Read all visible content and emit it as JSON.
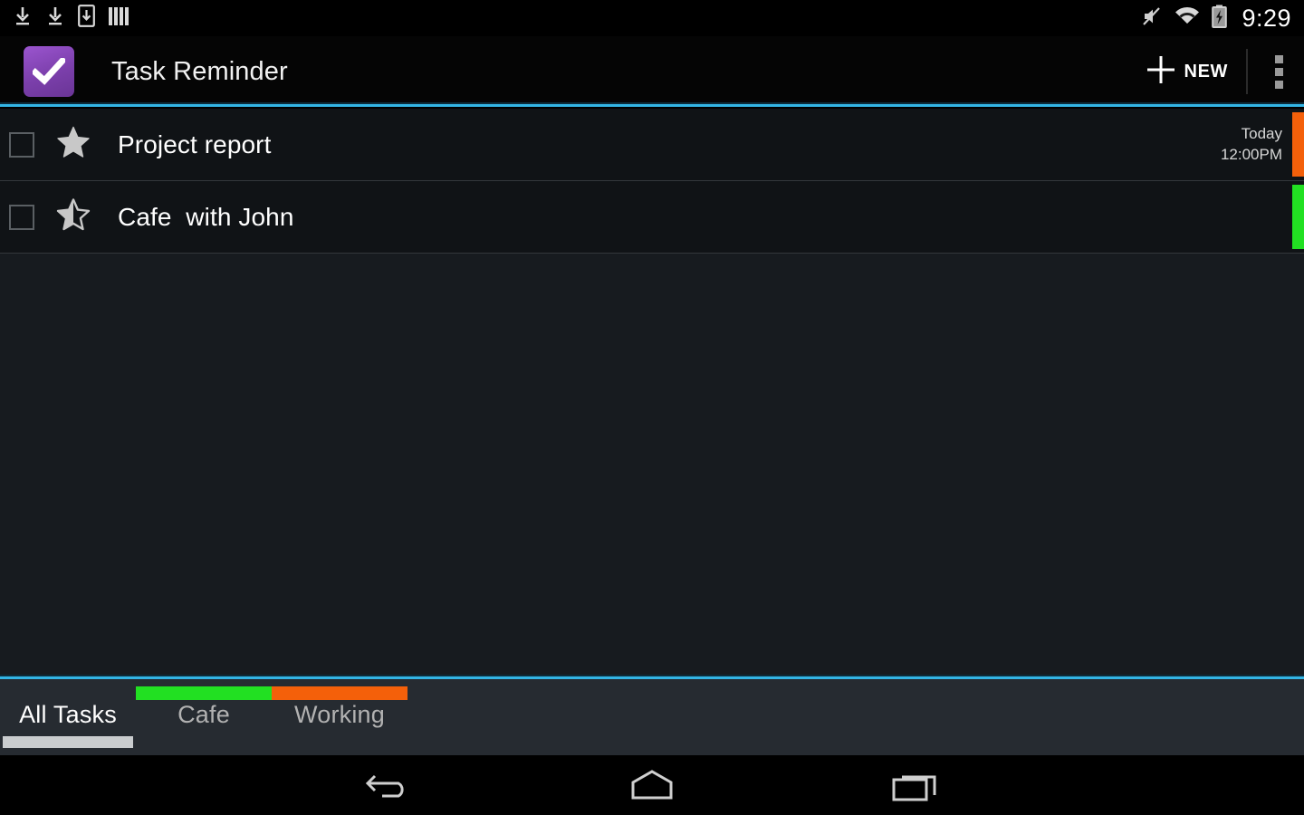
{
  "status_bar": {
    "left_icons": [
      {
        "name": "download-arrow-icon",
        "label": "download"
      },
      {
        "name": "download-arrow-icon",
        "label": "download"
      },
      {
        "name": "download-to-device-icon",
        "label": "save to device"
      },
      {
        "name": "equalizer-bars-icon",
        "label": "bars"
      }
    ],
    "right_icons": [
      {
        "name": "volume-muted-icon",
        "label": "silent"
      },
      {
        "name": "wifi-icon",
        "label": "wifi"
      },
      {
        "name": "battery-charging-icon",
        "label": "charging"
      }
    ],
    "time": "9:29"
  },
  "action_bar": {
    "app_icon": "checkmark-icon",
    "title": "Task Reminder",
    "new_label": "NEW",
    "plus_icon": "plus-icon",
    "overflow_icon": "overflow-menu-icon"
  },
  "tasks": [
    {
      "title": "Project report",
      "checked": false,
      "starred": "full",
      "due_day": "Today",
      "due_time": "12:00PM",
      "color": "#f4600a"
    },
    {
      "title": "Cafe  with John",
      "checked": false,
      "starred": "half",
      "due_day": "",
      "due_time": "",
      "color": "#22e022"
    }
  ],
  "tabs": [
    {
      "label": "All Tasks",
      "selected": true,
      "color": null
    },
    {
      "label": "Cafe",
      "selected": false,
      "color": "#22e022"
    },
    {
      "label": "Working",
      "selected": false,
      "color": "#f4600a"
    }
  ],
  "nav_bar": {
    "back": "back-icon",
    "home": "home-icon",
    "recents": "recent-apps-icon"
  },
  "colors": {
    "accent_cyan": "#33b5e5",
    "app_purple": "#8a4abf",
    "green": "#22e022",
    "orange": "#f4600a"
  }
}
